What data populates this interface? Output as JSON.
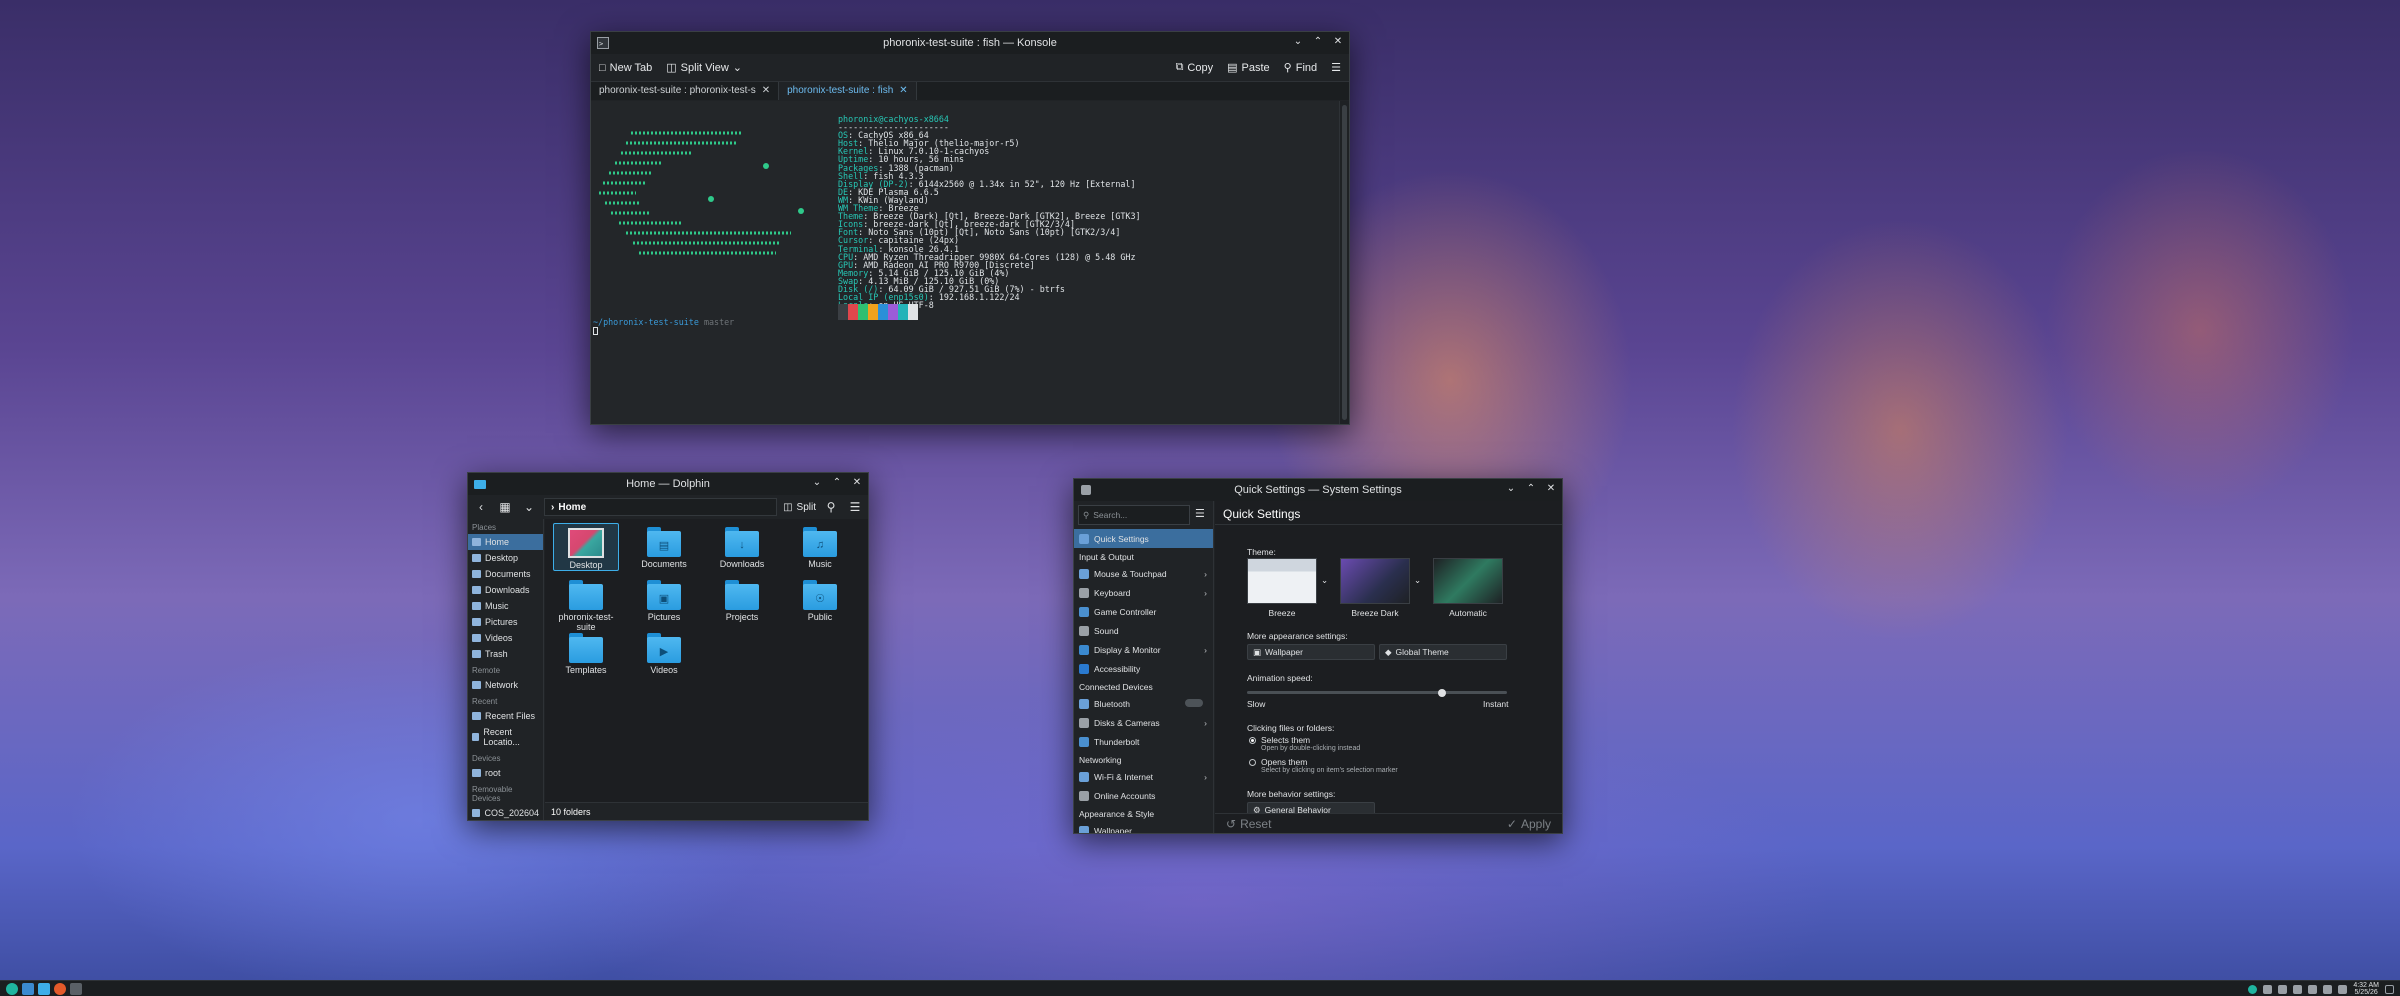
{
  "konsole": {
    "title": "phoronix-test-suite : fish — Konsole",
    "toolbar": {
      "new_tab": "New Tab",
      "split_view": "Split View",
      "copy": "Copy",
      "paste": "Paste",
      "find": "Find"
    },
    "tabs": [
      "phoronix-test-suite : phoronix-test-s",
      "phoronix-test-suite : fish"
    ],
    "userhost": "phoronix@cachyos-x8664",
    "separator": "----------------------",
    "info": [
      {
        "k": "OS",
        "v": ": CachyOS x86_64"
      },
      {
        "k": "Host",
        "v": ": Thelio Major (thelio-major-r5)"
      },
      {
        "k": "Kernel",
        "v": ": Linux 7.0.10-1-cachyos"
      },
      {
        "k": "Uptime",
        "v": ": 10 hours, 56 mins"
      },
      {
        "k": "Packages",
        "v": ": 1388 (pacman)"
      },
      {
        "k": "Shell",
        "v": ": fish 4.3.3"
      },
      {
        "k": "Display (DP-2)",
        "v": ": 6144x2560 @ 1.34x in 52\", 120 Hz [External]"
      },
      {
        "k": "DE",
        "v": ": KDE Plasma 6.6.5"
      },
      {
        "k": "WM",
        "v": ": KWin (Wayland)"
      },
      {
        "k": "WM Theme",
        "v": ": Breeze"
      },
      {
        "k": "Theme",
        "v": ": Breeze (Dark) [Qt], Breeze-Dark [GTK2], Breeze [GTK3]"
      },
      {
        "k": "Icons",
        "v": ": breeze-dark [Qt], breeze-dark [GTK2/3/4]"
      },
      {
        "k": "Font",
        "v": ": Noto Sans (10pt) [Qt], Noto Sans (10pt) [GTK2/3/4]"
      },
      {
        "k": "Cursor",
        "v": ": capitaine (24px)"
      },
      {
        "k": "Terminal",
        "v": ": konsole 26.4.1"
      },
      {
        "k": "CPU",
        "v": ": AMD Ryzen Threadripper 9980X 64-Cores (128) @ 5.48 GHz"
      },
      {
        "k": "GPU",
        "v": ": AMD Radeon AI PRO R9700 [Discrete]"
      },
      {
        "k": "Memory",
        "v": ": 5.14 GiB / 125.10 GiB (4%)"
      },
      {
        "k": "Swap",
        "v": ": 4.13 MiB / 125.10 GiB (0%)"
      },
      {
        "k": "Disk (/)",
        "v": ": 64.09 GiB / 927.51 GiB (7%) - btrfs"
      },
      {
        "k": "Local IP (enp15s0)",
        "v": ": 192.168.1.122/24"
      },
      {
        "k": "Locale",
        "v": ": en_US.UTF-8"
      }
    ],
    "prompt_dir": "~/phoronix-test-suite",
    "prompt_branch": "master",
    "palette": [
      "#3b3f44",
      "#e0464c",
      "#2fbf71",
      "#f0a21e",
      "#2b8fd8",
      "#9b5cd8",
      "#23b3b8",
      "#dfe3e6"
    ]
  },
  "dolphin": {
    "title": "Home — Dolphin",
    "location": "Home",
    "split": "Split",
    "places_header": "Places",
    "places": [
      "Home",
      "Desktop",
      "Documents",
      "Downloads",
      "Music",
      "Pictures",
      "Videos",
      "Trash"
    ],
    "remote_header": "Remote",
    "remote": [
      "Network"
    ],
    "recent_header": "Recent",
    "recent": [
      "Recent Files",
      "Recent Locatio..."
    ],
    "devices_header": "Devices",
    "devices": [
      "root"
    ],
    "removable_header": "Removable Devices",
    "removable": [
      "COS_202604"
    ],
    "folders": [
      "Desktop",
      "Documents",
      "Downloads",
      "Music",
      "phoronix-test-suite",
      "Pictures",
      "Projects",
      "Public",
      "Templates",
      "Videos"
    ],
    "status": "10 folders"
  },
  "settings": {
    "title": "Quick Settings — System Settings",
    "search_placeholder": "Search...",
    "sidebar": {
      "quick": "Quick Settings",
      "input_header": "Input & Output",
      "input": [
        "Mouse & Touchpad",
        "Keyboard",
        "Game Controller",
        "Sound",
        "Display & Monitor",
        "Accessibility"
      ],
      "connected_header": "Connected Devices",
      "connected": [
        "Bluetooth",
        "Disks & Cameras",
        "Thunderbolt"
      ],
      "network_header": "Networking",
      "network": [
        "Wi-Fi & Internet",
        "Online Accounts"
      ],
      "appearance_header": "Appearance & Style",
      "appearance": [
        "Wallpaper"
      ]
    },
    "page_title": "Quick Settings",
    "theme_label": "Theme:",
    "themes": [
      "Breeze",
      "Breeze Dark",
      "Automatic"
    ],
    "more_appearance": "More appearance settings:",
    "wallpaper_btn": "Wallpaper",
    "global_theme_btn": "Global Theme",
    "animation_label": "Animation speed:",
    "slow": "Slow",
    "instant": "Instant",
    "clicking_label": "Clicking files or folders:",
    "selects_them": "Selects them",
    "selects_sub": "Open by double-clicking instead",
    "opens_them": "Opens them",
    "opens_sub": "Select by clicking on item's selection marker",
    "more_behavior": "More behavior settings:",
    "general_behavior_btn": "General Behavior",
    "reset": "Reset",
    "apply": "Apply"
  },
  "taskbar": {
    "time": "4:32 AM",
    "date": "5/25/26"
  }
}
